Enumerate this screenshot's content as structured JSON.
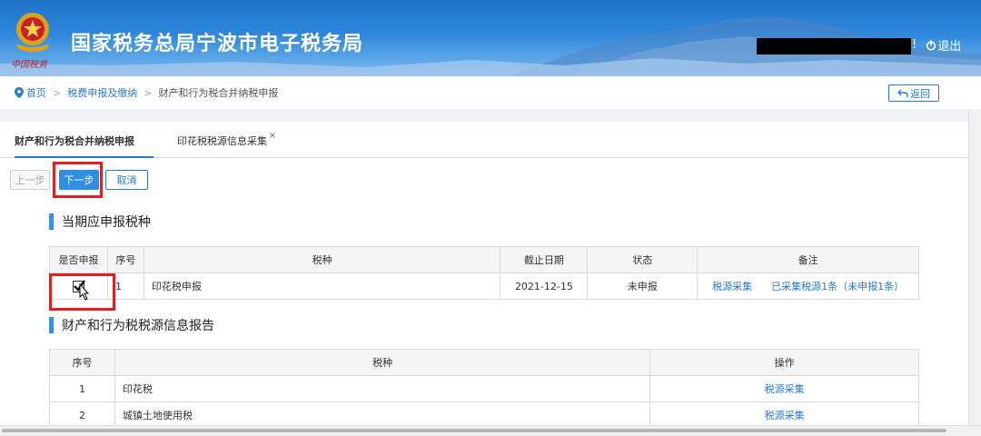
{
  "header": {
    "title": "国家税务总局宁波市电子税务局",
    "emblem_caption": "中国税务",
    "user_icon_partial": "!",
    "logout_label": "退出"
  },
  "breadcrumb": {
    "home": "首页",
    "level1": "税费申报及缴纳",
    "current": "财产和行为税合并纳税申报",
    "back_label": "返回"
  },
  "tabs": [
    {
      "label": "财产和行为税合并纳税申报",
      "active": true
    },
    {
      "label": "印花税税源信息采集",
      "closable": true,
      "close_glyph": "×"
    }
  ],
  "actions": {
    "prev": "上一步",
    "next": "下一步",
    "cancel": "取消"
  },
  "section1": {
    "title": "当期应申报税种",
    "headers": [
      "是否申报",
      "序号",
      "税种",
      "截止日期",
      "状态",
      "备注"
    ],
    "rows": [
      {
        "checked": true,
        "seq": "1",
        "tax": "印花税申报",
        "deadline": "2021-12-15",
        "status": "未申报",
        "note_link1": "税源采集",
        "note_link2": "已采集税源1条（未申报1条）"
      }
    ]
  },
  "section2": {
    "title": "财产和行为税税源信息报告",
    "headers": [
      "序号",
      "税种",
      "操作"
    ],
    "rows": [
      {
        "seq": "1",
        "tax": "印花税",
        "action": "税源采集"
      },
      {
        "seq": "2",
        "tax": "城镇土地使用税",
        "action": "税源采集"
      }
    ]
  },
  "colors": {
    "accent": "#2c7ad3",
    "primary_button": "#2f8de4",
    "highlight_box": "#e02020",
    "section_bar": "#3c8fe0"
  }
}
